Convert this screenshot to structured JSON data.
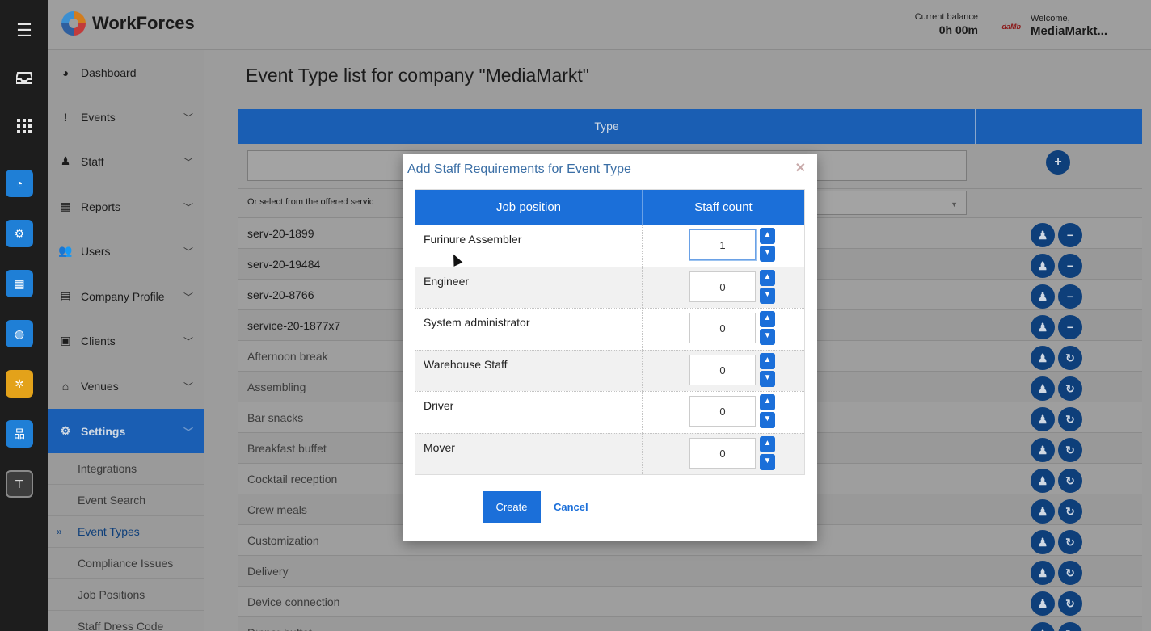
{
  "app": {
    "name": "WorkForces"
  },
  "header": {
    "balance_label": "Current balance",
    "balance_value": "0h 00m",
    "welcome_label": "Welcome,",
    "welcome_user": "MediaMarkt...",
    "company_logo_text": "daMb"
  },
  "sidebar": {
    "items": [
      {
        "label": "Dashboard",
        "icon": "dashboard-icon",
        "chevron": false
      },
      {
        "label": "Events",
        "icon": "exclamation-icon",
        "chevron": true
      },
      {
        "label": "Staff",
        "icon": "person-icon",
        "chevron": true
      },
      {
        "label": "Reports",
        "icon": "table-icon",
        "chevron": true
      },
      {
        "label": "Users",
        "icon": "users-icon",
        "chevron": true
      },
      {
        "label": "Company Profile",
        "icon": "building-icon",
        "chevron": true
      },
      {
        "label": "Clients",
        "icon": "money-icon",
        "chevron": true
      },
      {
        "label": "Venues",
        "icon": "home-icon",
        "chevron": true
      },
      {
        "label": "Settings",
        "icon": "gears-icon",
        "chevron": true
      }
    ],
    "settings_sub": [
      "Integrations",
      "Event Search",
      "Event Types",
      "Compliance Issues",
      "Job Positions",
      "Staff Dress Code"
    ],
    "current_sub": "Event Types"
  },
  "page": {
    "title": "Event Type list for company \"MediaMarkt\"",
    "table_header": "Type",
    "select_label": "Or select from the offered servic",
    "rows": [
      {
        "name": "serv-20-1899",
        "custom": true
      },
      {
        "name": "serv-20-19484",
        "custom": true
      },
      {
        "name": "serv-20-8766",
        "custom": true
      },
      {
        "name": "service-20-1877x7",
        "custom": true
      },
      {
        "name": "Afternoon break",
        "custom": false
      },
      {
        "name": "Assembling",
        "custom": false
      },
      {
        "name": "Bar snacks",
        "custom": false
      },
      {
        "name": "Breakfast buffet",
        "custom": false
      },
      {
        "name": "Cocktail reception",
        "custom": false
      },
      {
        "name": "Crew meals",
        "custom": false
      },
      {
        "name": "Customization",
        "custom": false
      },
      {
        "name": "Delivery",
        "custom": false
      },
      {
        "name": "Device connection",
        "custom": false
      },
      {
        "name": "Dinner buffet",
        "custom": false
      }
    ]
  },
  "modal": {
    "title": "Add Staff Requirements for Event Type",
    "col_position": "Job position",
    "col_count": "Staff count",
    "rows": [
      {
        "position": "Furinure Assembler",
        "count": "1"
      },
      {
        "position": "Engineer",
        "count": "0"
      },
      {
        "position": "System administrator",
        "count": "0"
      },
      {
        "position": "Warehouse Staff",
        "count": "0"
      },
      {
        "position": "Driver",
        "count": "0"
      },
      {
        "position": "Mover",
        "count": "0"
      }
    ],
    "create_label": "Create",
    "cancel_label": "Cancel"
  },
  "colors": {
    "accent": "#1b6fd9",
    "nav_active": "#1a5eb3",
    "round_btn": "#0e3f7a"
  }
}
